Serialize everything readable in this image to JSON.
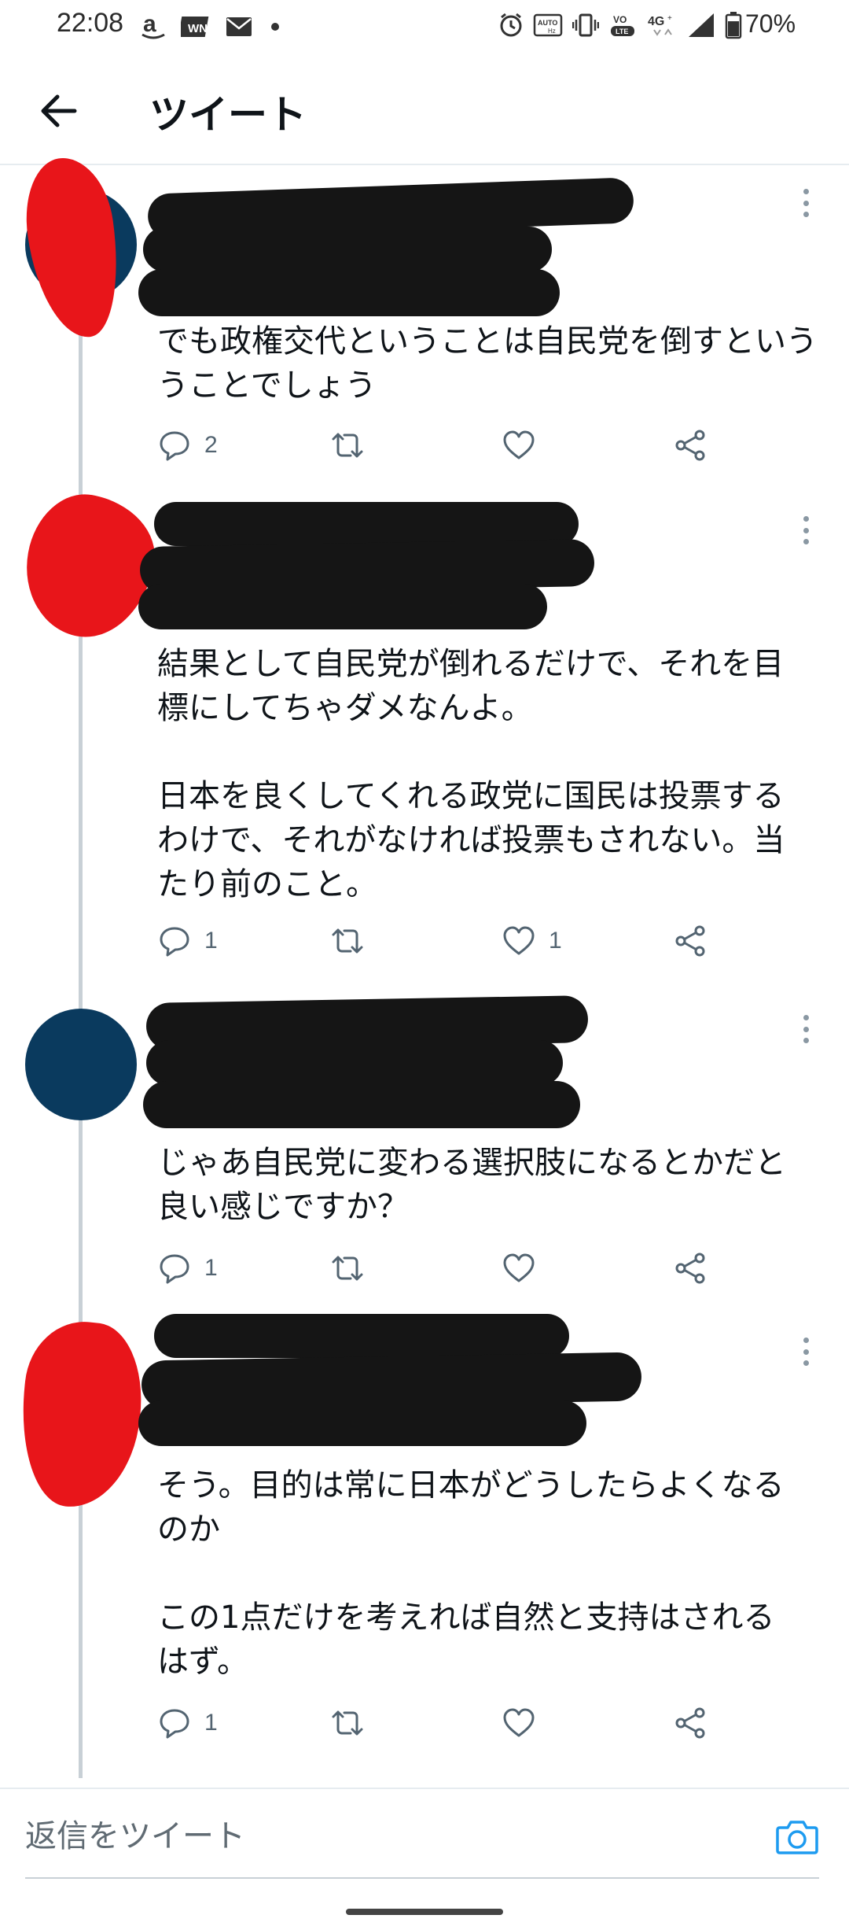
{
  "status_bar": {
    "time": "22:08",
    "battery": "70%",
    "network": "4G",
    "left_icons": [
      "amazon-icon",
      "weathernews-icon",
      "au-mail-icon",
      "notification-dot-icon"
    ],
    "right_icons": [
      "alarm-icon",
      "auto-hz-icon",
      "vibrate-icon",
      "volte-icon",
      "signal-icon",
      "battery-icon"
    ]
  },
  "header": {
    "back_icon": "arrow-left-icon",
    "title": "ツイート"
  },
  "tweets": [
    {
      "text": "でも政権交代ということは自民党を倒すという\nうことでしょう",
      "reply_count": "2",
      "retweet_count": "",
      "like_count": ""
    },
    {
      "text": "結果として自民党が倒れるだけで、それを目\n標にしてちゃダメなんよ。\n\n日本を良くしてくれる政党に国民は投票する\nわけで、それがなければ投票もされない。当\nたり前のこと。",
      "reply_count": "1",
      "retweet_count": "",
      "like_count": "1"
    },
    {
      "text": "じゃあ自民党に変わる選択肢になるとかだと\n良い感じですか？",
      "reply_count": "1",
      "retweet_count": "",
      "like_count": ""
    },
    {
      "text": "そう。目的は常に日本がどうしたらよくなる\nのか\n\nこの1点だけを考えれば自然と支持はされる\nはず。",
      "reply_count": "1",
      "retweet_count": "",
      "like_count": ""
    }
  ],
  "reply_bar": {
    "placeholder": "返信をツイート",
    "camera_icon": "camera-icon"
  },
  "colors": {
    "accent": "#1d9bf0",
    "text": "#0f1419",
    "muted": "#536471",
    "thread_line": "#c8d0d6",
    "avatar": "#0a3a5e",
    "redaction_red": "#e8151a",
    "redaction_black": "#151515"
  }
}
